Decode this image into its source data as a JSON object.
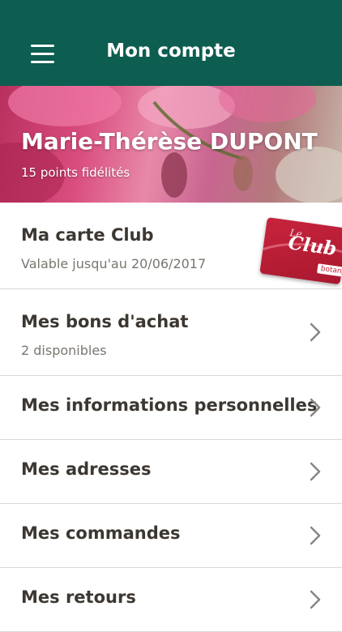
{
  "header": {
    "title": "Mon compte",
    "menu_icon": "hamburger-menu-icon"
  },
  "hero": {
    "name": "Marie-Thérèse DUPONT",
    "points": "15 points fidélités"
  },
  "club_card": {
    "brand_small": "Le",
    "brand": "Club",
    "brand_suffix": "botan"
  },
  "menu": [
    {
      "title": "Ma carte Club",
      "subtitle": "Valable jusqu'au 20/06/2017"
    },
    {
      "title": "Mes bons d'achat",
      "subtitle": "2 disponibles"
    },
    {
      "title": "Mes informations personnelles"
    },
    {
      "title": "Mes adresses"
    },
    {
      "title": "Mes commandes"
    },
    {
      "title": "Mes retours"
    }
  ],
  "colors": {
    "header": "#0d5d50",
    "card": "#c8243d",
    "text": "#3c3731"
  }
}
